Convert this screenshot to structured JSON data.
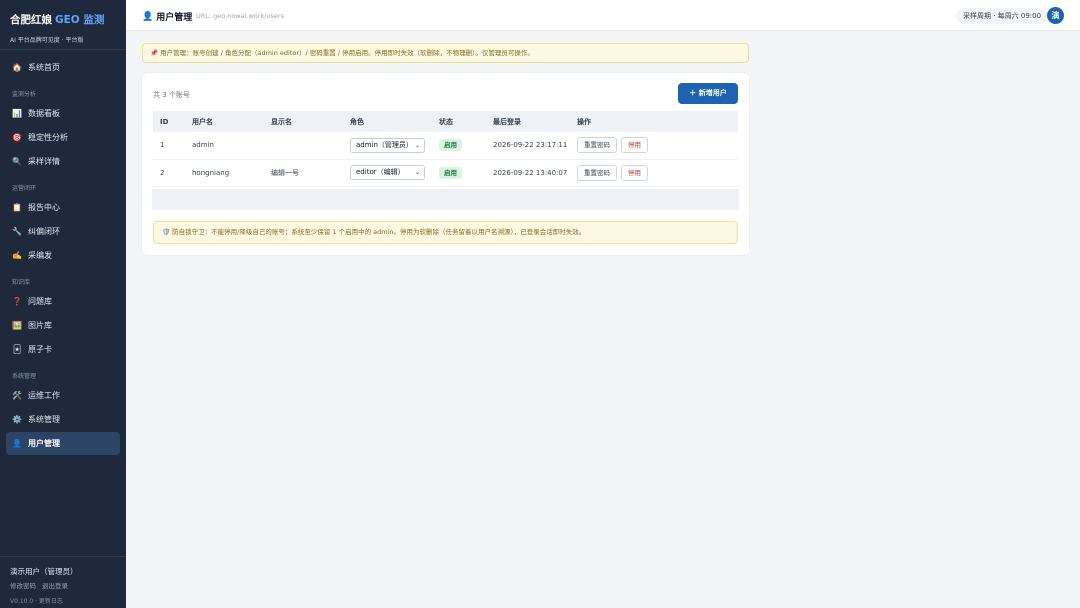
{
  "sidebar": {
    "brand_name": "合肥红娘",
    "brand_accent": "GEO 监测",
    "brand_subtitle": "AI 平台品牌可见度 · 平台版",
    "home": {
      "label": "系统首页",
      "icon": "house-icon"
    },
    "sections": [
      {
        "title": "监测分析",
        "items": [
          {
            "label": "数据看板",
            "icon": "bar-chart-icon"
          },
          {
            "label": "稳定性分析",
            "icon": "target-icon"
          },
          {
            "label": "采样详情",
            "icon": "magnifier-icon"
          }
        ]
      },
      {
        "title": "运营闭环",
        "items": [
          {
            "label": "报告中心",
            "icon": "clipboard-icon"
          },
          {
            "label": "纠偏闭环",
            "icon": "wrench-icon"
          },
          {
            "label": "采编发",
            "icon": "writing-hand-icon"
          }
        ]
      },
      {
        "title": "知识库",
        "items": [
          {
            "label": "问题库",
            "icon": "question-icon"
          },
          {
            "label": "图片库",
            "icon": "image-icon"
          },
          {
            "label": "原子卡",
            "icon": "card-icon"
          }
        ]
      },
      {
        "title": "系统管理",
        "items": [
          {
            "label": "运维工作",
            "icon": "tools-icon"
          },
          {
            "label": "系统管理",
            "icon": "gear-icon"
          },
          {
            "label": "用户管理",
            "icon": "user-icon",
            "active": true
          }
        ]
      }
    ],
    "footer": {
      "user": "演示用户（管理员）",
      "change_password": "修改密码",
      "logout": "退出登录",
      "version": "V0.10.0 · 更新日志"
    }
  },
  "topbar": {
    "title": "用户管理",
    "url": "URL: geo.nowai.work/users",
    "period": "采样周期 · 每周六 09:00",
    "avatar": "演"
  },
  "notice": "📌 用户管理：账号创建 / 角色分配（admin editor）/ 密码重置 / 停用启用。停用即时失效（软删除，不物理删）。仅管理员可操作。",
  "users": {
    "count_text": "共 3 个账号",
    "add_button": "＋ 新增用户",
    "columns": [
      "ID",
      "用户名",
      "显示名",
      "角色",
      "状态",
      "最后登录",
      "操作"
    ],
    "rows": [
      {
        "id": "1",
        "username": "admin",
        "display_name": "",
        "role": "admin（管理员）",
        "status": "启用",
        "last_login": "2026-09-22 23:17:11",
        "reset_label": "重置密码",
        "disable_label": "停用"
      },
      {
        "id": "2",
        "username": "hongniang",
        "display_name": "编辑一号",
        "role": "editor（编辑）",
        "status": "启用",
        "last_login": "2026-09-22 13:40:07",
        "reset_label": "重置密码",
        "disable_label": "停用"
      }
    ],
    "guard_note": "🛡️ 防自锁守卫：不能停用/降级自己的账号；系统至少保留 1 个启用中的 admin。停用为软删除（任务留着以用户名溯源），已登录会话即时失效。"
  },
  "colors": {
    "sidebar_bg": "#1e2a3b",
    "brand_accent": "#60a5fa",
    "primary": "#1e63b0",
    "success_badge": "#1e7a42",
    "danger_text": "#c0392b",
    "notice_bg": "#fdf8e1"
  }
}
